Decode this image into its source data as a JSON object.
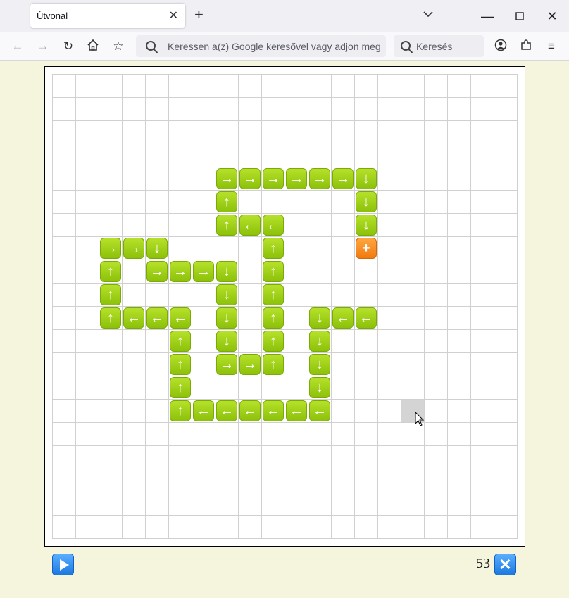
{
  "browser": {
    "tab_title": "Útvonal",
    "new_tab_symbol": "+",
    "url_placeholder": "Keressen a(z) Google keresővel vagy adjon meg eg",
    "search_placeholder": "Keresés"
  },
  "board": {
    "columns": 20,
    "rows": 20,
    "highlighted_cell": {
      "col": 15,
      "row": 14
    },
    "tiles": [
      {
        "col": 7,
        "row": 4,
        "dir": "right"
      },
      {
        "col": 8,
        "row": 4,
        "dir": "right"
      },
      {
        "col": 9,
        "row": 4,
        "dir": "right"
      },
      {
        "col": 10,
        "row": 4,
        "dir": "right"
      },
      {
        "col": 11,
        "row": 4,
        "dir": "right"
      },
      {
        "col": 12,
        "row": 4,
        "dir": "right"
      },
      {
        "col": 13,
        "row": 4,
        "dir": "down"
      },
      {
        "col": 7,
        "row": 5,
        "dir": "up"
      },
      {
        "col": 13,
        "row": 5,
        "dir": "down"
      },
      {
        "col": 7,
        "row": 6,
        "dir": "up"
      },
      {
        "col": 8,
        "row": 6,
        "dir": "left"
      },
      {
        "col": 9,
        "row": 6,
        "dir": "left"
      },
      {
        "col": 13,
        "row": 6,
        "dir": "down"
      },
      {
        "col": 2,
        "row": 7,
        "dir": "right"
      },
      {
        "col": 3,
        "row": 7,
        "dir": "right"
      },
      {
        "col": 4,
        "row": 7,
        "dir": "down"
      },
      {
        "col": 9,
        "row": 7,
        "dir": "up"
      },
      {
        "col": 13,
        "row": 7,
        "dir": "plus"
      },
      {
        "col": 2,
        "row": 8,
        "dir": "up"
      },
      {
        "col": 4,
        "row": 8,
        "dir": "right"
      },
      {
        "col": 5,
        "row": 8,
        "dir": "right"
      },
      {
        "col": 6,
        "row": 8,
        "dir": "right"
      },
      {
        "col": 7,
        "row": 8,
        "dir": "down"
      },
      {
        "col": 9,
        "row": 8,
        "dir": "up"
      },
      {
        "col": 2,
        "row": 9,
        "dir": "up"
      },
      {
        "col": 7,
        "row": 9,
        "dir": "down"
      },
      {
        "col": 9,
        "row": 9,
        "dir": "up"
      },
      {
        "col": 2,
        "row": 10,
        "dir": "up"
      },
      {
        "col": 3,
        "row": 10,
        "dir": "left"
      },
      {
        "col": 4,
        "row": 10,
        "dir": "left"
      },
      {
        "col": 5,
        "row": 10,
        "dir": "left"
      },
      {
        "col": 7,
        "row": 10,
        "dir": "down"
      },
      {
        "col": 9,
        "row": 10,
        "dir": "up"
      },
      {
        "col": 11,
        "row": 10,
        "dir": "down"
      },
      {
        "col": 12,
        "row": 10,
        "dir": "left"
      },
      {
        "col": 13,
        "row": 10,
        "dir": "left"
      },
      {
        "col": 5,
        "row": 11,
        "dir": "up"
      },
      {
        "col": 7,
        "row": 11,
        "dir": "down"
      },
      {
        "col": 9,
        "row": 11,
        "dir": "up"
      },
      {
        "col": 11,
        "row": 11,
        "dir": "down"
      },
      {
        "col": 5,
        "row": 12,
        "dir": "up"
      },
      {
        "col": 7,
        "row": 12,
        "dir": "right"
      },
      {
        "col": 8,
        "row": 12,
        "dir": "right"
      },
      {
        "col": 9,
        "row": 12,
        "dir": "up"
      },
      {
        "col": 11,
        "row": 12,
        "dir": "down"
      },
      {
        "col": 5,
        "row": 13,
        "dir": "up"
      },
      {
        "col": 11,
        "row": 13,
        "dir": "down"
      },
      {
        "col": 5,
        "row": 14,
        "dir": "up"
      },
      {
        "col": 6,
        "row": 14,
        "dir": "left"
      },
      {
        "col": 7,
        "row": 14,
        "dir": "left"
      },
      {
        "col": 8,
        "row": 14,
        "dir": "left"
      },
      {
        "col": 9,
        "row": 14,
        "dir": "left"
      },
      {
        "col": 10,
        "row": 14,
        "dir": "left"
      },
      {
        "col": 11,
        "row": 14,
        "dir": "left"
      }
    ]
  },
  "controls": {
    "counter": "53",
    "play_icon": "play-icon",
    "clear_icon": "clear-icon"
  },
  "colors": {
    "tile_green": "#9fd11a",
    "tile_orange": "#f88a20",
    "button_blue": "#2a8af0",
    "page_bg": "#f5f4dc"
  }
}
